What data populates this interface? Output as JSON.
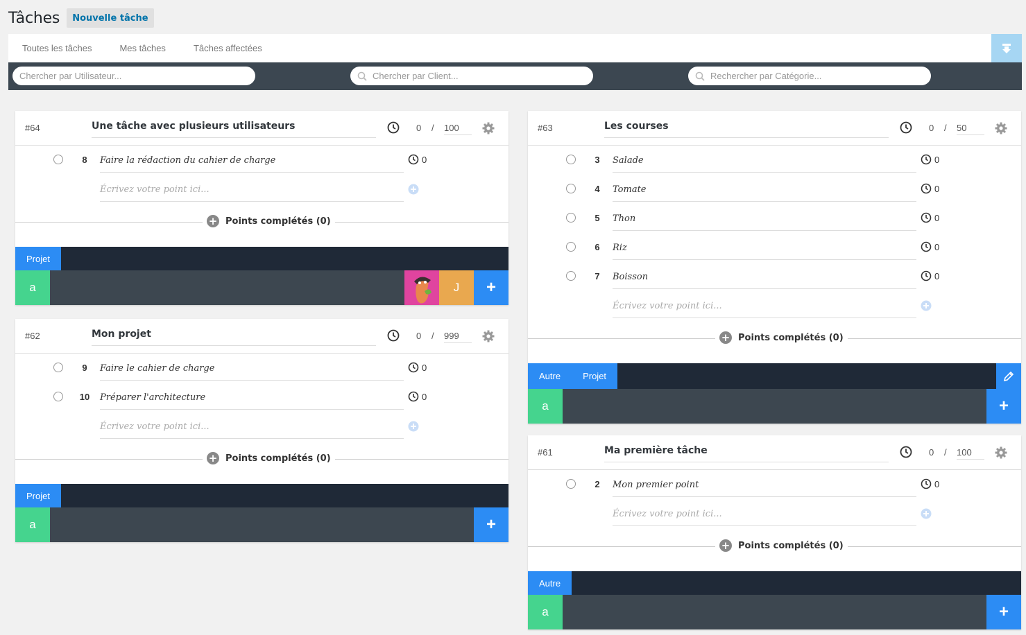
{
  "header": {
    "title": "Tâches",
    "new_task_label": "Nouvelle tâche"
  },
  "tabs": [
    "Toutes les tâches",
    "Mes tâches",
    "Tâches affectées"
  ],
  "search": {
    "user_placeholder": "Chercher par Utilisateur...",
    "client_placeholder": "Chercher par Client...",
    "category_placeholder": "Rechercher par Catégorie..."
  },
  "colors": {
    "primary": "#2c8cf4",
    "user_a": "#45d48e",
    "user_j": "#e9a84f",
    "user_img": "#e0449f",
    "dark_bar": "#1f2937",
    "user_bar": "#3d4750"
  },
  "cards": [
    {
      "id": "#64",
      "title": "Une tâche avec plusieurs utilisateurs",
      "elapsed": "0",
      "sep": "/",
      "estimate": "100",
      "points": [
        {
          "num": "8",
          "text": "Faire la rédaction du cahier de charge",
          "time": "0"
        }
      ],
      "placeholder": "Écrivez votre point ici...",
      "completed_label": "Points complétés (0)",
      "categories": [
        "Projet"
      ],
      "users": [
        "a",
        "avatar-image",
        "J"
      ]
    },
    {
      "id": "#62",
      "title": "Mon projet",
      "elapsed": "0",
      "sep": "/",
      "estimate": "999",
      "points": [
        {
          "num": "9",
          "text": "Faire le cahier de charge",
          "time": "0"
        },
        {
          "num": "10",
          "text": "Préparer l'architecture",
          "time": "0"
        }
      ],
      "placeholder": "Écrivez votre point ici...",
      "completed_label": "Points complétés (0)",
      "categories": [
        "Projet"
      ],
      "users": [
        "a"
      ]
    },
    {
      "id": "#63",
      "title": "Les courses",
      "elapsed": "0",
      "sep": "/",
      "estimate": "50",
      "points": [
        {
          "num": "3",
          "text": "Salade",
          "time": "0"
        },
        {
          "num": "4",
          "text": "Tomate",
          "time": "0"
        },
        {
          "num": "5",
          "text": "Thon",
          "time": "0"
        },
        {
          "num": "6",
          "text": "Riz",
          "time": "0"
        },
        {
          "num": "7",
          "text": "Boisson",
          "time": "0"
        }
      ],
      "placeholder": "Écrivez votre point ici...",
      "completed_label": "Points complétés (0)",
      "categories": [
        "Autre",
        "Projet"
      ],
      "users": [
        "a"
      ]
    },
    {
      "id": "#61",
      "title": "Ma première tâche",
      "elapsed": "0",
      "sep": "/",
      "estimate": "100",
      "points": [
        {
          "num": "2",
          "text": "Mon premier point",
          "time": "0"
        }
      ],
      "placeholder": "Écrivez votre point ici...",
      "completed_label": "Points complétés (0)",
      "categories": [
        "Autre"
      ],
      "users": [
        "a"
      ]
    }
  ]
}
